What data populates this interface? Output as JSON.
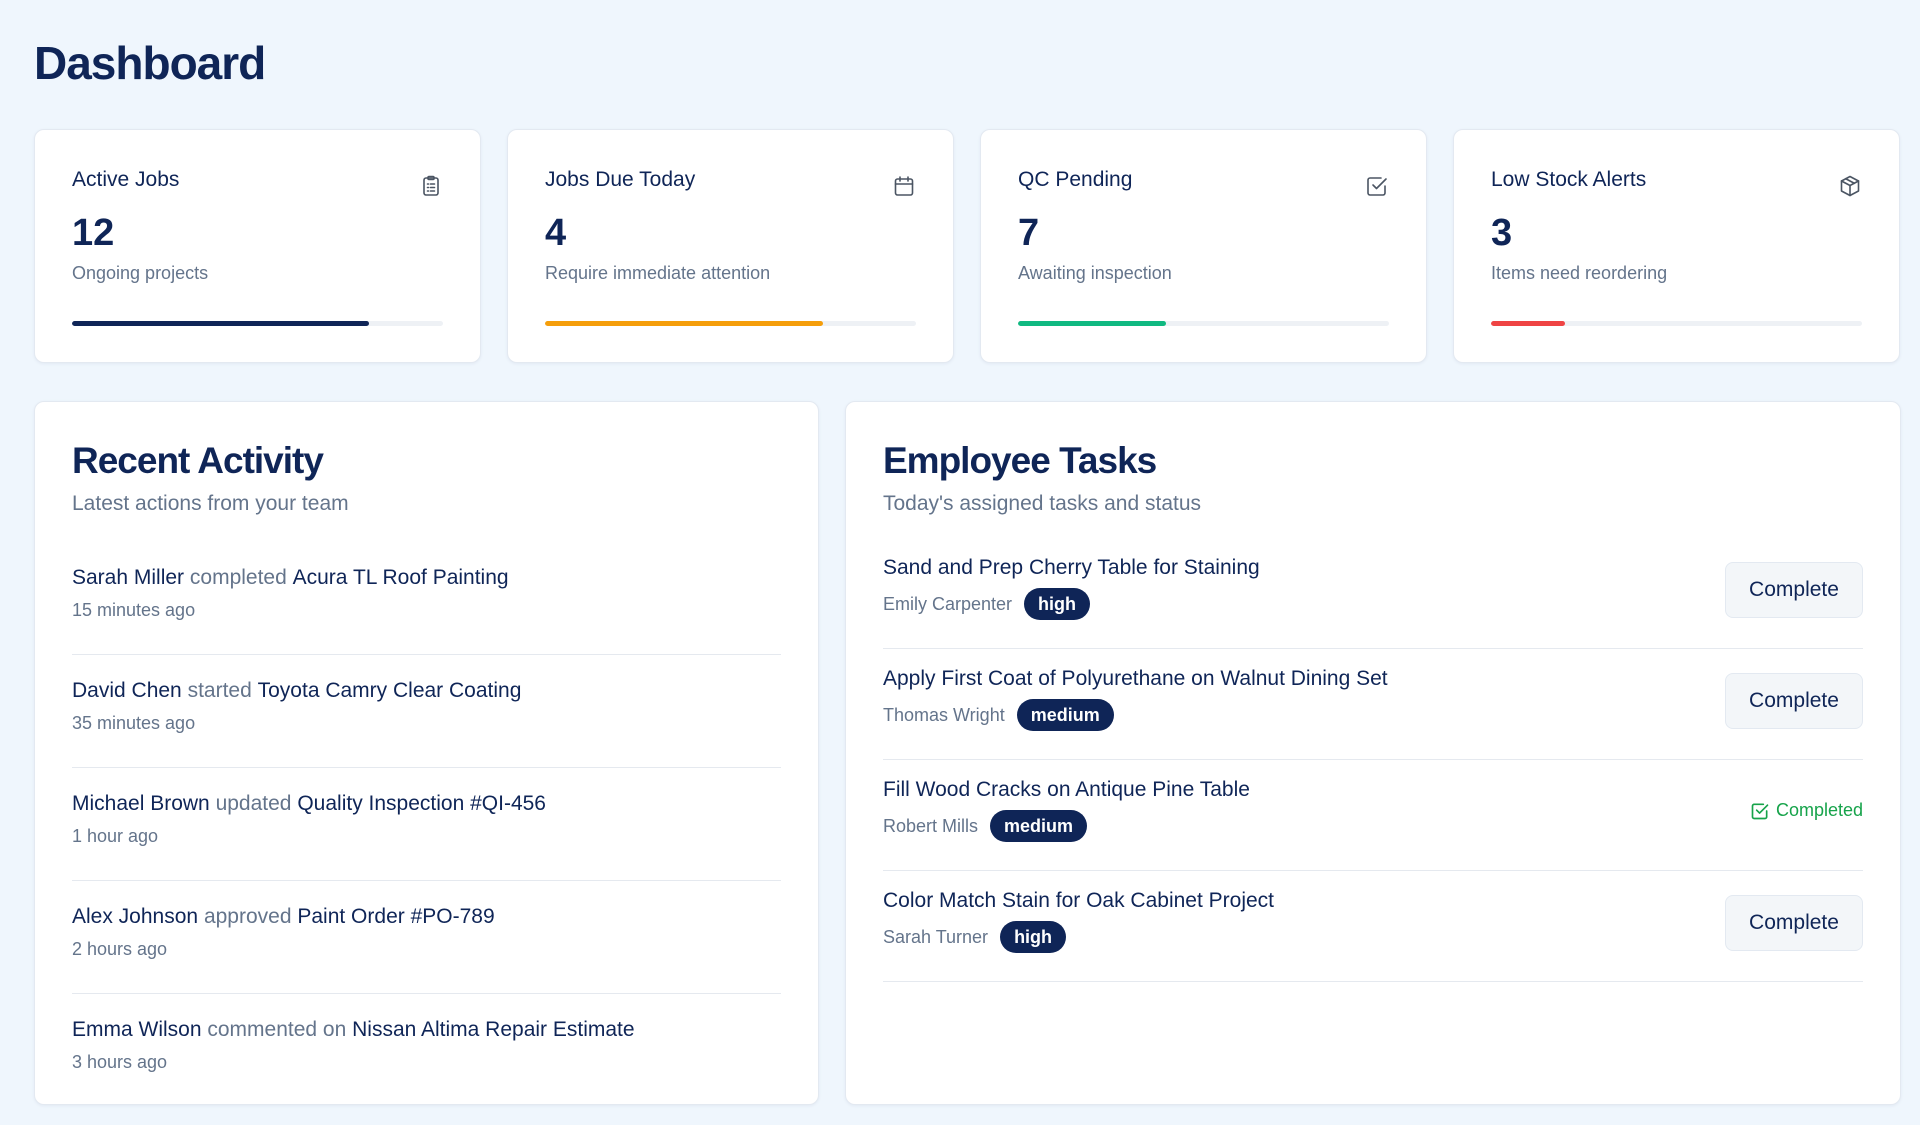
{
  "page": {
    "title": "Dashboard"
  },
  "stats": [
    {
      "label": "Active Jobs",
      "value": "12",
      "sub": "Ongoing projects",
      "icon": "clipboard-icon",
      "bar_color": "#0f2557",
      "progress": 0.8
    },
    {
      "label": "Jobs Due Today",
      "value": "4",
      "sub": "Require immediate attention",
      "icon": "calendar-icon",
      "bar_color": "#f59e0b",
      "progress": 0.75
    },
    {
      "label": "QC Pending",
      "value": "7",
      "sub": "Awaiting inspection",
      "icon": "check-square-icon",
      "bar_color": "#10b981",
      "progress": 0.4
    },
    {
      "label": "Low Stock Alerts",
      "value": "3",
      "sub": "Items need reordering",
      "icon": "package-icon",
      "bar_color": "#ef4444",
      "progress": 0.2
    }
  ],
  "activity": {
    "title": "Recent Activity",
    "subtitle": "Latest actions from your team",
    "items": [
      {
        "person": "Sarah Miller",
        "verb": "completed",
        "target": "Acura TL Roof Painting",
        "time": "15 minutes ago"
      },
      {
        "person": "David Chen",
        "verb": "started",
        "target": "Toyota Camry Clear Coating",
        "time": "35 minutes ago"
      },
      {
        "person": "Michael Brown",
        "verb": "updated",
        "target": "Quality Inspection #QI-456",
        "time": "1 hour ago"
      },
      {
        "person": "Alex Johnson",
        "verb": "approved",
        "target": "Paint Order #PO-789",
        "time": "2 hours ago"
      },
      {
        "person": "Emma Wilson",
        "verb": "commented on",
        "target": "Nissan Altima Repair Estimate",
        "time": "3 hours ago"
      }
    ]
  },
  "tasks": {
    "title": "Employee Tasks",
    "subtitle": "Today's assigned tasks and status",
    "complete_label": "Complete",
    "completed_label": "Completed",
    "items": [
      {
        "title": "Sand and Prep Cherry Table for Staining",
        "person": "Emily Carpenter",
        "priority": "high",
        "done": false
      },
      {
        "title": "Apply First Coat of Polyurethane on Walnut Dining Set",
        "person": "Thomas Wright",
        "priority": "medium",
        "done": false
      },
      {
        "title": "Fill Wood Cracks on Antique Pine Table",
        "person": "Robert Mills",
        "priority": "medium",
        "done": true
      },
      {
        "title": "Color Match Stain for Oak Cabinet Project",
        "person": "Sarah Turner",
        "priority": "high",
        "done": false
      }
    ]
  },
  "colors": {
    "navy": "#0f2557",
    "muted": "#64748b",
    "success": "#16a34a",
    "background": "#eff6fd"
  }
}
